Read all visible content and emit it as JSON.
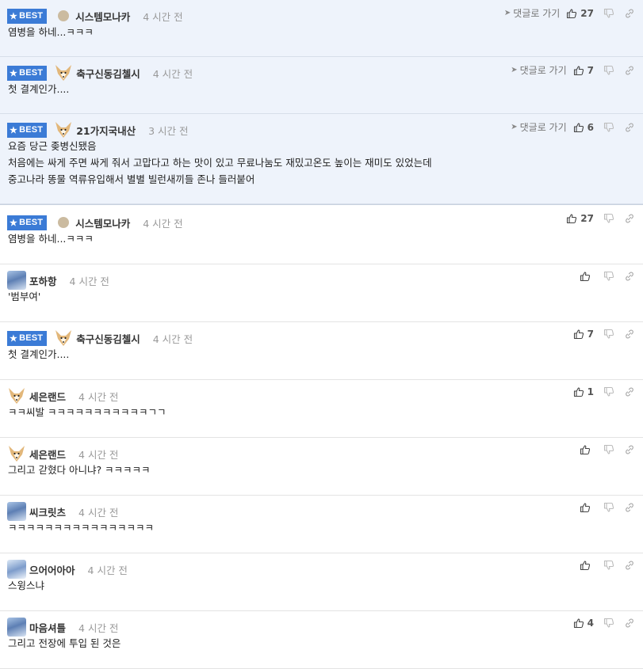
{
  "best_badge": "BEST",
  "goto_label": "댓글로 가기",
  "best_comments": [
    {
      "nick": "시스템모나카",
      "time": "4 시간 전",
      "text": [
        "염병을 하네...ㅋㅋㅋ"
      ],
      "likes": "27",
      "avatar": "dot"
    },
    {
      "nick": "축구신동김첼시",
      "time": "4 시간 전",
      "text": [
        "첫 결계인가...."
      ],
      "likes": "7",
      "avatar": "dog"
    },
    {
      "nick": "21가지국내산",
      "time": "3 시간 전",
      "text": [
        "요즘 당근 좆병신됐음",
        "처음에는 싸게 주면 싸게 줘서 고맙다고 하는 맛이 있고 무료나눔도 재밌고온도 높이는 재미도 있었는데",
        "중고나라 똥물 역류유입해서 별별 빌런새끼들 존나 들러붙어"
      ],
      "likes": "6",
      "avatar": "dog"
    }
  ],
  "comments": [
    {
      "best": true,
      "nick": "시스템모나카",
      "time": "4 시간 전",
      "text": "염병을 하네...ㅋㅋㅋ",
      "likes": "27",
      "avatar": "dot"
    },
    {
      "best": false,
      "nick": "포하항",
      "time": "4 시간 전",
      "text": "'범부여'",
      "likes": "",
      "avatar": "bear"
    },
    {
      "best": true,
      "nick": "축구신동김첼시",
      "time": "4 시간 전",
      "text": "첫 결계인가....",
      "likes": "7",
      "avatar": "dog"
    },
    {
      "best": false,
      "nick": "세은랜드",
      "time": "4 시간 전",
      "text": "ㅋㅋ씨발 ㅋㅋㅋㅋㅋㅋㅋㅋㅋㅋㅋㄱㄱ",
      "likes": "1",
      "avatar": "dog"
    },
    {
      "best": false,
      "nick": "세은랜드",
      "time": "4 시간 전",
      "text": "그리고 갇혔다 아니냐? ㅋㅋㅋㅋㅋ",
      "likes": "",
      "avatar": "dog"
    },
    {
      "best": false,
      "nick": "씨크릿츠",
      "time": "4 시간 전",
      "text": "ㅋㅋㅋㅋㅋㅋㅋㅋㅋㅋㅋㅋㅋㅋㅋㅋ",
      "likes": "",
      "avatar": "bear"
    },
    {
      "best": false,
      "nick": "으어어아아",
      "time": "4 시간 전",
      "text": "스윙스냐",
      "likes": "",
      "avatar": "bear-small"
    },
    {
      "best": false,
      "nick": "마음셔틀",
      "time": "4 시간 전",
      "text": "그리고 전장에 투입 된 것은",
      "likes": "4",
      "avatar": "bear"
    }
  ]
}
